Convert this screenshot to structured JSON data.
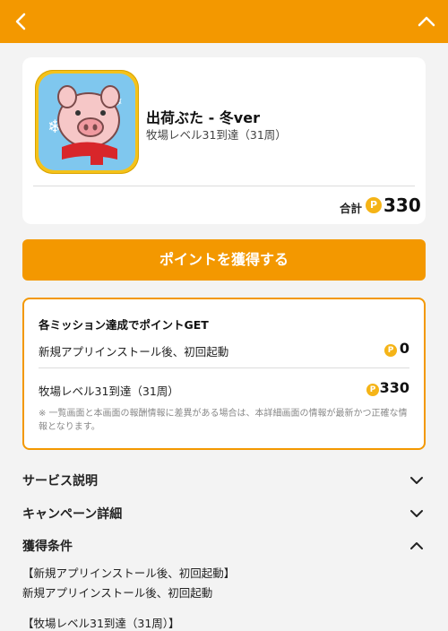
{
  "header": {
    "back_icon": "chevron-left-icon",
    "collapse_icon": "chevron-up-icon",
    "bg_color": "#f39800"
  },
  "app": {
    "title": "出荷ぶた - 冬ver",
    "condition": "牧場レベル31到達（31周）",
    "icon": "pig-app-icon"
  },
  "total": {
    "label": "合計",
    "coin_symbol": "P",
    "value": "330"
  },
  "get_button": {
    "label": "ポイントを獲得する"
  },
  "missions": {
    "header": "各ミッション達成でポイントGET",
    "items": [
      {
        "label": "新規アプリインストール後、初回起動",
        "coin_symbol": "P",
        "value": "0"
      },
      {
        "label": "牧場レベル31到達（31周）",
        "coin_symbol": "P",
        "value": "330"
      }
    ],
    "note": "※ 一覧画面と本画面の報酬情報に差異がある場合は、本詳細画面の情報が最新かつ正確な情報となります。"
  },
  "sections": [
    {
      "title": "サービス説明",
      "state": "collapsed"
    },
    {
      "title": "キャンペーン詳細",
      "state": "collapsed"
    },
    {
      "title": "獲得条件",
      "state": "expanded"
    }
  ],
  "conditions": [
    "【新規アプリインストール後、初回起動】",
    "新規アプリインストール後、初回起動",
    "【牧場レベル31到達（31周）】"
  ],
  "colors": {
    "accent": "#f39800",
    "coin": "#f5b417",
    "background": "#f3f3f3"
  }
}
